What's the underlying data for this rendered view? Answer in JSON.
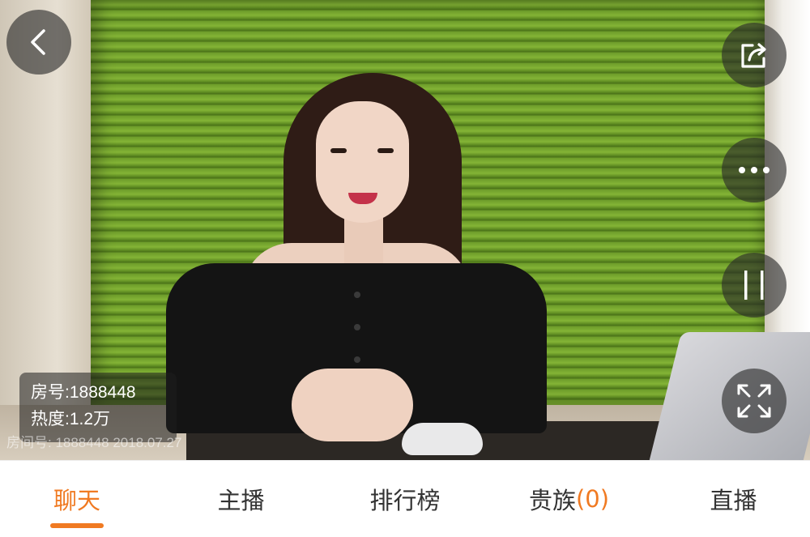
{
  "stream": {
    "room_line": "房号:1888448",
    "heat_line": "热度:1.2万",
    "watermark": "房间号: 1888448   2018.07.27"
  },
  "controls": {
    "back_icon": "chevron-left-icon",
    "share_icon": "share-icon",
    "more_icon": "more-dots-icon",
    "pause_icon": "pause-icon",
    "fullscreen_icon": "fullscreen-icon"
  },
  "tabs": [
    {
      "label": "聊天",
      "active": true
    },
    {
      "label": "主播",
      "active": false
    },
    {
      "label": "排行榜",
      "active": false
    },
    {
      "label": "贵族",
      "count": "(0)",
      "active": false
    },
    {
      "label": "直播",
      "active": false
    }
  ],
  "colors": {
    "accent": "#f07a22",
    "tab_text": "#333333",
    "overlay": "#282828"
  }
}
